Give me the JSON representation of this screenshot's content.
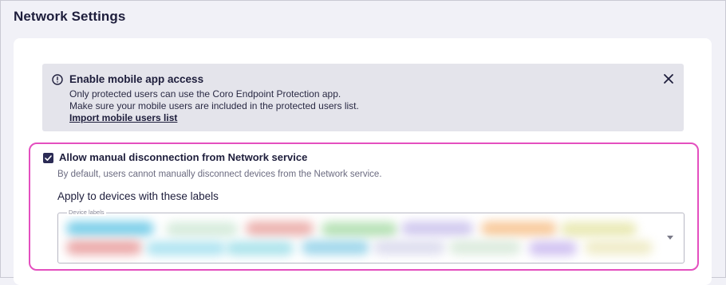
{
  "page": {
    "title": "Network Settings"
  },
  "banner": {
    "title": "Enable mobile app access",
    "line1": "Only protected users can use the Coro Endpoint Protection app.",
    "line2": "Make sure your mobile users are included in the protected users list.",
    "link": "Import mobile users list",
    "icon": "info-icon",
    "close_icon": "close-icon"
  },
  "manual_disconnection": {
    "checked": true,
    "label": "Allow manual disconnection from Network service",
    "description": "By default, users cannot manually disconnect devices from the Network service.",
    "apply_label": "Apply to devices with these labels"
  },
  "device_labels": {
    "legend": "Device labels",
    "chip_colors": [
      "#66c7e6",
      "#cfe8d6",
      "#e9a4a0",
      "#a9dca8",
      "#c9c0ec",
      "#f7c18a",
      "#e6e6a8",
      "#8fd0e8",
      "#e89a9a",
      "#a3e0ef",
      "#d8d8ec",
      "#9fdfe9",
      "#d6e8d8",
      "#c9b8ef",
      "#ede9bf"
    ],
    "dropdown_icon": "chevron-down-icon"
  },
  "colors": {
    "highlight": "#e44fbf",
    "accent": "#2b2b55"
  }
}
